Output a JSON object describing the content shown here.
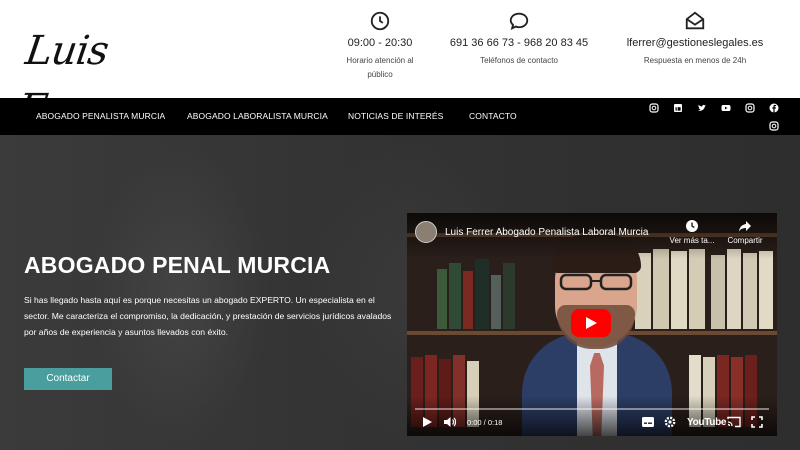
{
  "header": {
    "logo_text": "Luis Ferrer",
    "hours": {
      "main": "09:00 - 20:30",
      "sub": "Horario atención al público",
      "icon": "clock-icon"
    },
    "phone": {
      "main": "691 36 66 73 - 968 20 83 45",
      "sub": "Teléfonos de contacto",
      "icon": "chat-bubble-icon"
    },
    "email": {
      "main": "lferrer@gestioneslegales.es",
      "sub": "Respuesta en menos de 24h",
      "icon": "envelope-open-icon"
    }
  },
  "nav": {
    "items": [
      {
        "label": "ABOGADO PENALISTA MURCIA"
      },
      {
        "label": "ABOGADO LABORALISTA MURCIA"
      },
      {
        "label": "NOTICIAS DE INTERÉS"
      },
      {
        "label": "CONTACTO"
      }
    ],
    "social": [
      "instagram-icon",
      "linkedin-icon",
      "twitter-icon",
      "youtube-icon",
      "instagram-icon",
      "facebook-icon",
      "instagram-icon"
    ]
  },
  "hero": {
    "title": "ABOGADO PENAL MURCIA",
    "text": "Si has llegado hasta aquí es porque necesitas un abogado EXPERTO. Un especialista en el sector. Me caracteriza el compromiso, la dedicación, y prestación de servicios jurídicos avalados por años de experiencia y asuntos llevados con éxito.",
    "cta_label": "Contactar",
    "accent_color": "#4a9e9e"
  },
  "video": {
    "title": "Luis Ferrer Abogado Penalista Laboral Murcia",
    "watch_later": "Ver más ta...",
    "share": "Compartir",
    "time": "0:00 / 0:18",
    "brand": "YouTube"
  }
}
